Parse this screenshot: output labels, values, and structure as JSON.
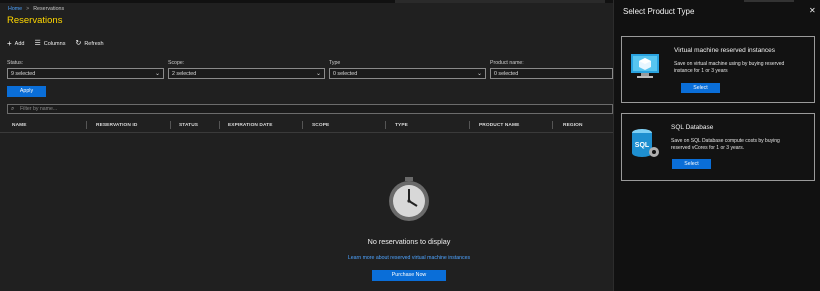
{
  "breadcrumb": {
    "home": "Home",
    "current": "Reservations"
  },
  "page": {
    "title": "Reservations"
  },
  "toolbar": {
    "add": "Add",
    "columns": "Columns",
    "refresh": "Refresh"
  },
  "filters": [
    {
      "label": "Status:",
      "value": "9 selected"
    },
    {
      "label": "Scope:",
      "value": "2 selected"
    },
    {
      "label": "Type",
      "value": "0 selected"
    },
    {
      "label": "Product name:",
      "value": "0 selected"
    }
  ],
  "apply_label": "Apply",
  "filter_placeholder": "Filter by name...",
  "columns": [
    "NAME",
    "RESERVATION ID",
    "STATUS",
    "EXPIRATION DATE",
    "SCOPE",
    "TYPE",
    "PRODUCT NAME",
    "REGION"
  ],
  "empty_state": {
    "message": "No reservations to display",
    "link": "Learn more about reserved virtual machine instances",
    "button": "Purchase Now"
  },
  "panel": {
    "title": "Select Product Type",
    "cards": [
      {
        "title": "Virtual machine reserved instances",
        "desc1": "Save on virtual machine using by buying reserved",
        "desc2": "instance for 1 or 3 years",
        "button": "Select",
        "icon": "vm-monitor-icon"
      },
      {
        "title": "SQL Database",
        "desc1": "Save on SQL Database compute costs by buying",
        "desc2": "reserved vCores for 1 or 3 years.",
        "button": "Select",
        "icon": "sql-database-icon"
      }
    ]
  },
  "colors": {
    "accent": "#0a6ed8",
    "title": "#ffd700",
    "link": "#4da3ff",
    "background": "#202020",
    "panel": "#111111"
  }
}
